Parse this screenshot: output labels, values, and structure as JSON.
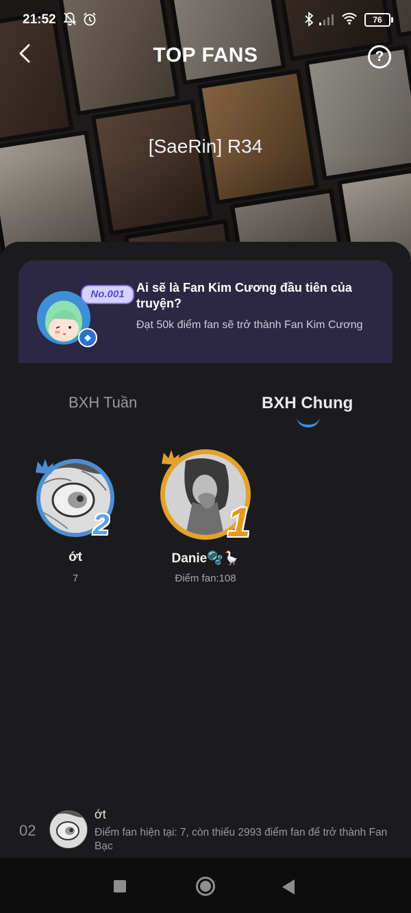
{
  "status_bar": {
    "time": "21:52",
    "battery": "76",
    "icons": [
      "bell-off-icon",
      "alarm-icon",
      "bluetooth-icon",
      "signal-icon",
      "wifi-icon",
      "battery-icon"
    ]
  },
  "header": {
    "title": "TOP FANS",
    "back_icon": "chevron-left-icon",
    "help_icon": "question-circle-icon",
    "story_name": "[SaeRin] R34"
  },
  "banner": {
    "badge": "No.001",
    "title": "Ai sẽ là Fan Kim Cương đầu tiên của truyện?",
    "subtitle": "Đạt 50k điểm fan sẽ trở thành Fan Kim Cương"
  },
  "tabs": [
    {
      "label": "BXH Tuần",
      "active": false
    },
    {
      "label": "BXH Chung",
      "active": true
    }
  ],
  "podium": [
    {
      "rank": "2",
      "name": "ớt",
      "points": "7"
    },
    {
      "rank": "1",
      "name": "Danie🫧🪿",
      "points": "Điểm fan:108"
    }
  ],
  "my_rank": {
    "position": "02",
    "name": "ớt",
    "description": "Điểm fan hiện tại: 7, còn thiếu 2993 điểm fan để trở thành Fan Bạc"
  },
  "colors": {
    "background": "#1b1b1d",
    "banner": "#2c2743",
    "accent_blue": "#3d8fe0",
    "gold": "#e3a22a",
    "silver_blue": "#4b8ed6"
  }
}
